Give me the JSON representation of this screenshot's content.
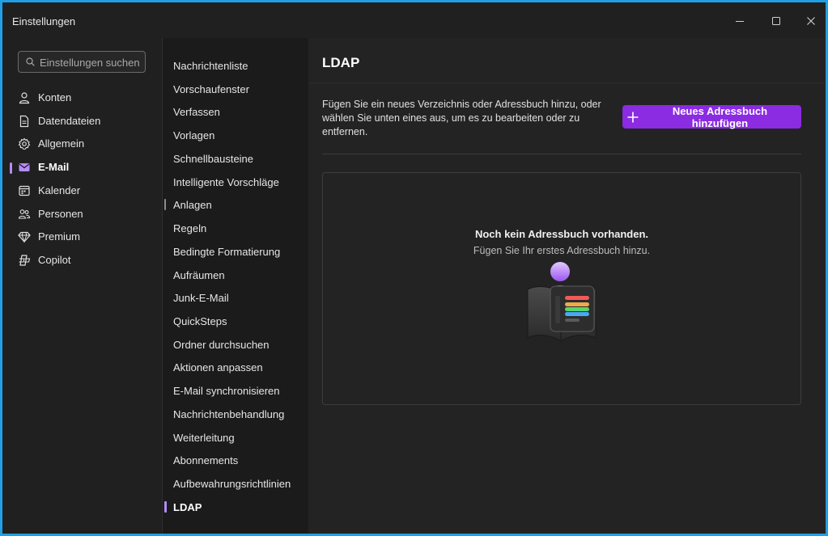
{
  "window": {
    "title": "Einstellungen",
    "controls": [
      "minimize",
      "maximize",
      "close"
    ]
  },
  "nav": {
    "search_placeholder": "Einstellungen suchen",
    "items": [
      {
        "label": "Konten",
        "icon": "person-icon"
      },
      {
        "label": "Datendateien",
        "icon": "document-icon"
      },
      {
        "label": "Allgemein",
        "icon": "gear-icon"
      },
      {
        "label": "E-Mail",
        "icon": "mail-icon",
        "active": true
      },
      {
        "label": "Kalender",
        "icon": "calendar-icon"
      },
      {
        "label": "Personen",
        "icon": "people-icon"
      },
      {
        "label": "Premium",
        "icon": "diamond-icon"
      },
      {
        "label": "Copilot",
        "icon": "copilot-icon"
      }
    ]
  },
  "subnav": {
    "items": [
      {
        "label": "Nachrichtenliste"
      },
      {
        "label": "Vorschaufenster"
      },
      {
        "label": "Verfassen"
      },
      {
        "label": "Vorlagen"
      },
      {
        "label": "Schnellbausteine"
      },
      {
        "label": "Intelligente Vorschläge"
      },
      {
        "label": "Anlagen",
        "hovered": true
      },
      {
        "label": "Regeln"
      },
      {
        "label": "Bedingte Formatierung"
      },
      {
        "label": "Aufräumen"
      },
      {
        "label": "Junk-E-Mail"
      },
      {
        "label": "QuickSteps"
      },
      {
        "label": "Ordner durchsuchen"
      },
      {
        "label": "Aktionen anpassen"
      },
      {
        "label": "E-Mail synchronisieren"
      },
      {
        "label": "Nachrichtenbehandlung"
      },
      {
        "label": "Weiterleitung"
      },
      {
        "label": "Abonnements"
      },
      {
        "label": "Aufbewahrungsrichtlinien"
      },
      {
        "label": "LDAP",
        "active": true
      }
    ]
  },
  "content": {
    "title": "LDAP",
    "description": "Fügen Sie ein neues Verzeichnis oder Adressbuch hinzu, oder wählen Sie unten eines aus, um es zu bearbeiten oder zu entfernen.",
    "add_button_label": "Neues Adressbuch hinzufügen",
    "empty_title": "Noch kein Adressbuch vorhanden.",
    "empty_subtitle": "Fügen Sie Ihr erstes Adressbuch hinzu."
  },
  "colors": {
    "accent": "#8b2be2",
    "indicator": "#b58cf8",
    "background": "#202020"
  }
}
